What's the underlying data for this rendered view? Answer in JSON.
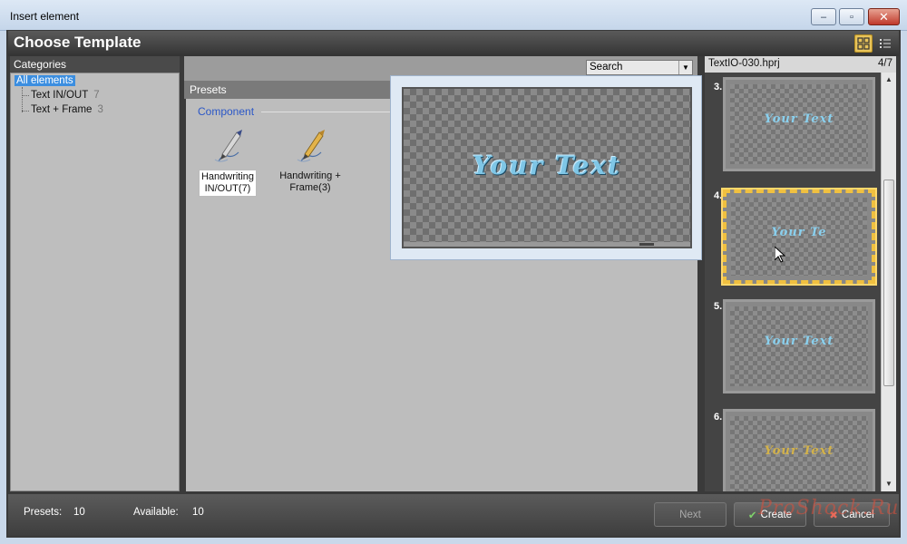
{
  "window": {
    "title": "Insert element",
    "min_label": "‒",
    "max_label": "▫",
    "close_label": "✕"
  },
  "header": {
    "title": "Choose Template"
  },
  "categories": {
    "heading": "Categories",
    "all_label": "All elements",
    "items": [
      {
        "label": "Text IN/OUT",
        "count": "7"
      },
      {
        "label": "Text + Frame",
        "count": "3"
      }
    ]
  },
  "search": {
    "value": "Search"
  },
  "presets": {
    "heading": "Presets",
    "group_label": "Component",
    "items": [
      {
        "label_line1": "Handwriting",
        "label_line2": "IN/OUT(7)"
      },
      {
        "label_line1": "Handwriting +",
        "label_line2": "Frame(3)"
      }
    ]
  },
  "preview": {
    "text": "Your Text"
  },
  "file_panel": {
    "filename": "TextIO-030.hprj",
    "page": "4/7",
    "thumbnails": [
      {
        "num": "3.",
        "text": "Your Text",
        "style": "blue"
      },
      {
        "num": "4.",
        "text": "Your Te",
        "style": "blue",
        "selected": true
      },
      {
        "num": "5.",
        "text": "Your Text",
        "style": "blue"
      },
      {
        "num": "6.",
        "text": "Your Text",
        "style": "gold"
      }
    ]
  },
  "footer": {
    "presets_label": "Presets:",
    "presets_value": "10",
    "available_label": "Available:",
    "available_value": "10",
    "next_label": "Next",
    "create_label": "Create",
    "cancel_label": "Cancel"
  },
  "watermark": "ProShock.Ru",
  "colors": {
    "accent_selection": "#3b8ee0",
    "selected_thumb_border": "#f0c040",
    "group_label": "#2b57c7"
  }
}
